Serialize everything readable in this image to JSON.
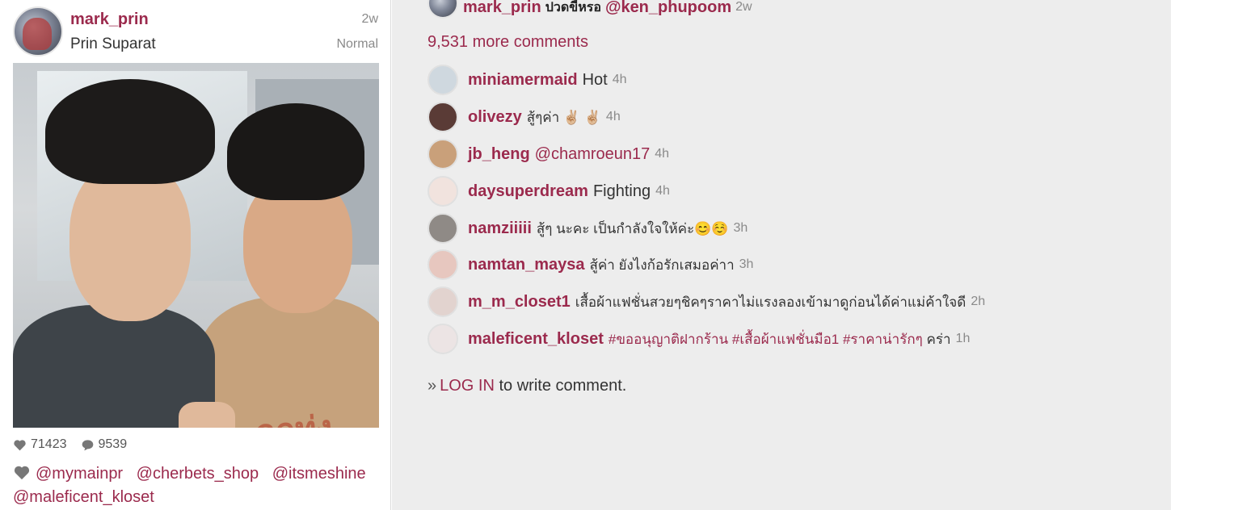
{
  "post": {
    "username": "mark_prin",
    "fullname": "Prin Suparat",
    "time": "2w",
    "filter": "Normal",
    "photo_print_text": "ลูกทุ่ง",
    "likes": "71423",
    "comments_count": "9539",
    "likers": [
      "@mymainpr",
      "@cherbets_shop",
      "@itsmeshine",
      "@maleficent_kloset"
    ]
  },
  "caption": {
    "username": "mark_prin",
    "text": "ปวดขี้หรอ",
    "mention": "@ken_phupoom",
    "time": "2w"
  },
  "more_comments": "9,531 more comments",
  "comments": [
    {
      "user": "miniamermaid",
      "text": "Hot",
      "time": "4h",
      "avatar_color": "#cfd8df"
    },
    {
      "user": "olivezy",
      "text": "สู้ๆค่า ✌🏼 ✌🏼",
      "time": "4h",
      "avatar_color": "#5a3b36"
    },
    {
      "user": "jb_heng",
      "text": "@chamroeun17",
      "time": "4h",
      "avatar_color": "#c9a07a"
    },
    {
      "user": "daysuperdream",
      "text": "Fighting",
      "time": "4h",
      "avatar_color": "#f1e3de"
    },
    {
      "user": "namziiiii",
      "text": "สู้ๆ นะคะ เป็นกำลังใจให้ค่ะ😊☺️",
      "time": "3h",
      "avatar_color": "#8f8a86"
    },
    {
      "user": "namtan_maysa",
      "text": "สู้ค่า ยังไงก้อรักเสมอค่าา",
      "time": "3h",
      "avatar_color": "#e7c7bf"
    },
    {
      "user": "m_m_closet1",
      "text": "เสื้อผ้าแฟชั่นสวยๆชิคๆราคาไม่แรงลองเข้ามาดูก่อนได้ค่าแม่ค้าใจดี",
      "time": "2h",
      "avatar_color": "#e2d3cf"
    },
    {
      "user": "maleficent_kloset",
      "text_tags": "#ขออนุญาติฝากร้าน #เสื้อผ้าแฟชั่นมือ1 #ราคาน่ารักๆ",
      "text_after": "คร่า",
      "time": "1h",
      "avatar_color": "#ece4e4"
    }
  ],
  "login": {
    "prefix": "»",
    "link": "LOG IN",
    "suffix": "to write comment."
  },
  "colors": {
    "accent": "#9b2a4d",
    "panel_bg": "#ededed",
    "muted": "#8a8a8a"
  }
}
